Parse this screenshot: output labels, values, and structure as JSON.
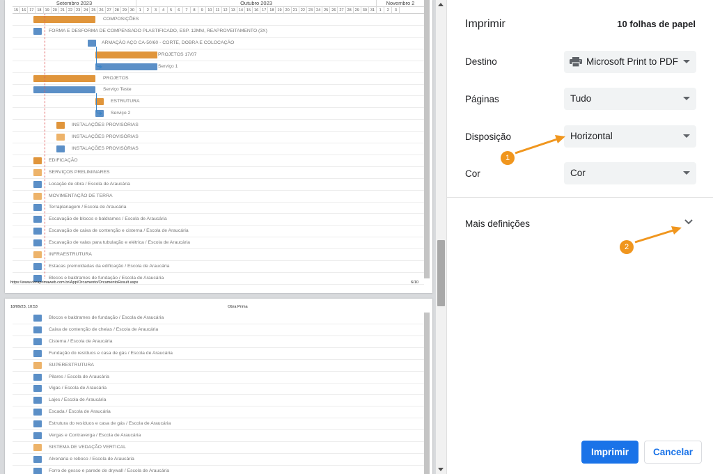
{
  "preview": {
    "page1": {
      "months": [
        "Setembro 2023",
        "Outubro 2023",
        "Novembro 2"
      ],
      "days_sep": [
        "15",
        "16",
        "17",
        "18",
        "19",
        "20",
        "21",
        "22",
        "23",
        "24",
        "25",
        "26",
        "27",
        "28",
        "29",
        "30"
      ],
      "days_oct": [
        "1",
        "2",
        "3",
        "4",
        "5",
        "6",
        "7",
        "8",
        "9",
        "10",
        "11",
        "12",
        "13",
        "14",
        "15",
        "16",
        "17",
        "18",
        "19",
        "20",
        "21",
        "22",
        "23",
        "24",
        "25",
        "26",
        "27",
        "28",
        "29",
        "30",
        "31"
      ],
      "days_nov": [
        "1",
        "2",
        "3"
      ],
      "tasks": [
        {
          "label": "COMPOSIÇÕES",
          "color": "orange"
        },
        {
          "label": "FORMA E DESFORMA DE COMPENSADO PLASTIFICADO, ESP. 12MM, REAPROVEITAMENTO (3X)",
          "color": "blue"
        },
        {
          "label": "ARMAÇÃO AÇO CA-50/60 - CORTE, DOBRA E COLOCAÇÃO",
          "color": "blue"
        },
        {
          "label": "PROJETOS 17/07",
          "color": "orange"
        },
        {
          "label": "Serviço 1",
          "color": "blue"
        },
        {
          "label": "PROJETOS",
          "color": "orange"
        },
        {
          "label": "Serviço Teste",
          "color": "blue"
        },
        {
          "label": "ESTRUTURA",
          "color": "orange"
        },
        {
          "label": "Serviço 2",
          "color": "blue"
        },
        {
          "label": "INSTALAÇÕES PROVISÓRIAS",
          "color": "orange"
        },
        {
          "label": "INSTALAÇÕES PROVISÓRIAS",
          "color": "lightorange"
        },
        {
          "label": "INSTALAÇÕES PROVISÓRIAS",
          "color": "blue"
        },
        {
          "label": "EDIFICAÇÃO",
          "color": "orange"
        },
        {
          "label": "SERVIÇOS PRELIMINARES",
          "color": "lightorange"
        },
        {
          "label": "Locação de obra / Escola de Araucária",
          "color": "blue"
        },
        {
          "label": "MOVIMENTAÇÃO DE TERRA",
          "color": "lightorange"
        },
        {
          "label": "Terraplanagem / Escola de Araucária",
          "color": "blue"
        },
        {
          "label": "Escavação de blocos e baldrames / Escola de Araucária",
          "color": "blue"
        },
        {
          "label": "Escavação de caixa de contenção e cisterna / Escola de Araucária",
          "color": "blue"
        },
        {
          "label": "Escavação de valas para tubulação e elétrica / Escola de Araucária",
          "color": "blue"
        },
        {
          "label": "INFRAESTRUTURA",
          "color": "lightorange"
        },
        {
          "label": "Estacas premoldadas da edificação / Escola de Araucária",
          "color": "blue"
        },
        {
          "label": "Blocos e baldrames de fundação / Escola de Araucária",
          "color": "blue"
        }
      ],
      "footer_url": "https://www.obraprimaweb.com.br/App/Orcamento/OrcamentoResult.aspx",
      "footer_page": "6/10"
    },
    "page2": {
      "header_date": "18/09/23, 10:53",
      "header_title": "Obra Prima",
      "tasks": [
        {
          "label": "Blocos e baldrames de fundação / Escola de Araucária",
          "color": "blue"
        },
        {
          "label": "Caixa de contenção de cheias / Escola de Araucária",
          "color": "blue"
        },
        {
          "label": "Cisterna / Escola de Araucária",
          "color": "blue"
        },
        {
          "label": "Fundação do resíduos e casa de gás / Escola de Araucária",
          "color": "blue"
        },
        {
          "label": "SUPERESTRUTURA",
          "color": "lightorange"
        },
        {
          "label": "Pilares / Escola de Araucária",
          "color": "blue"
        },
        {
          "label": "Vigas / Escola de Araucária",
          "color": "blue"
        },
        {
          "label": "Lajes / Escola de Araucária",
          "color": "blue"
        },
        {
          "label": "Escada / Escola de Araucária",
          "color": "blue"
        },
        {
          "label": "Estrutura do resíduos e casa de gás / Escola de Araucária",
          "color": "blue"
        },
        {
          "label": "Vergas e Contraverga / Escola de Araucária",
          "color": "blue"
        },
        {
          "label": "SISTEMA DE VEDAÇÃO VERTICAL",
          "color": "lightorange"
        },
        {
          "label": "Alvenaria e reboco / Escola de Araucária",
          "color": "blue"
        },
        {
          "label": "Forro de gesso e parede de drywall / Escola de Araucária",
          "color": "blue"
        },
        {
          "label": "",
          "color": "blue"
        }
      ]
    }
  },
  "settings": {
    "title": "Imprimir",
    "sheets": "10 folhas de papel",
    "destination_label": "Destino",
    "destination_value": "Microsoft Print to PDF",
    "destination_icon": "printer-icon",
    "pages_label": "Páginas",
    "pages_value": "Tudo",
    "layout_label": "Disposição",
    "layout_value": "Horizontal",
    "color_label": "Cor",
    "color_value": "Cor",
    "more_settings_label": "Mais definições",
    "print_button": "Imprimir",
    "cancel_button": "Cancelar",
    "accent_color": "#1a73e8"
  },
  "annotations": {
    "marker_1": "1",
    "marker_2": "2",
    "marker_color": "#f0961e"
  }
}
